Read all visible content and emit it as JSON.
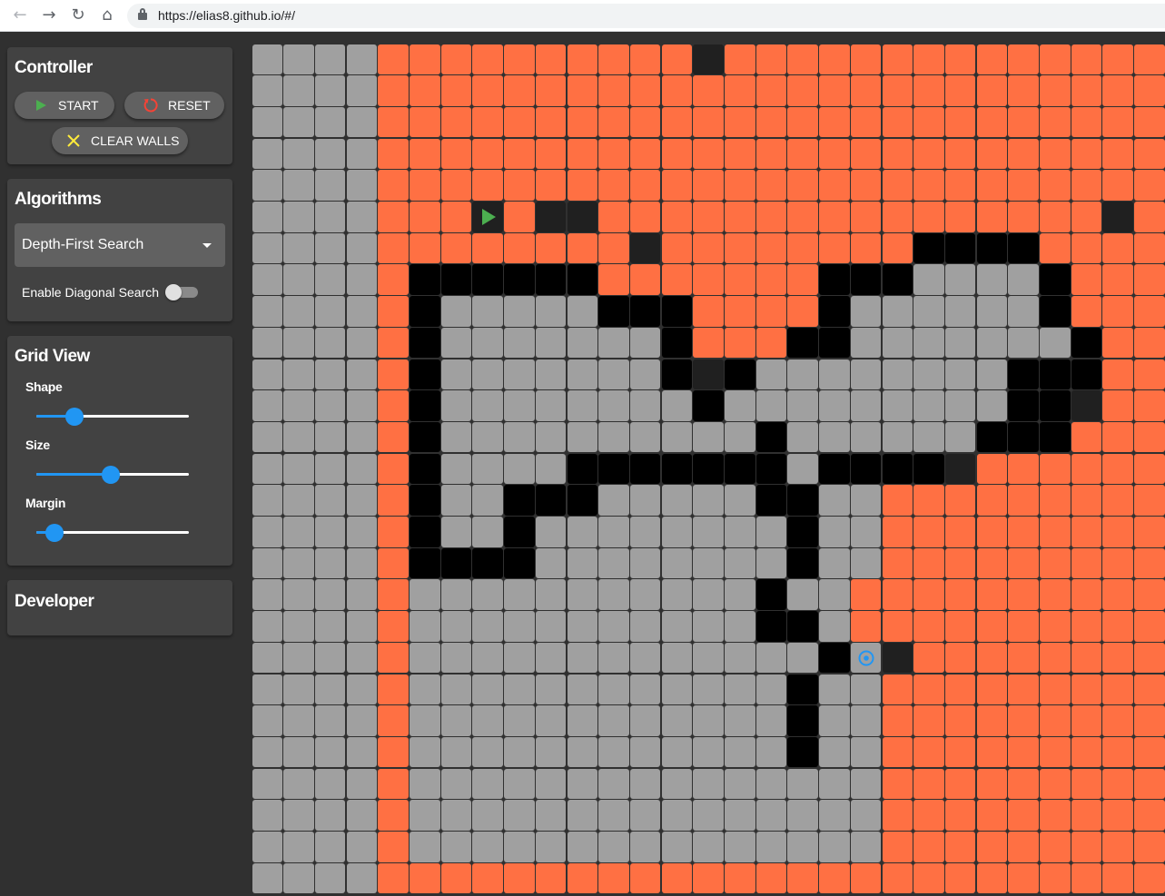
{
  "browser": {
    "url": "https://elias8.github.io/#/",
    "icons": [
      "back-icon",
      "forward-icon",
      "reload-icon",
      "home-icon",
      "lock-icon"
    ]
  },
  "controller": {
    "title": "Controller",
    "start_label": "START",
    "reset_label": "RESET",
    "clear_walls_label": "CLEAR WALLS"
  },
  "algorithms": {
    "title": "Algorithms",
    "selected": "Depth-First Search",
    "diagonal_label": "Enable Diagonal Search",
    "diagonal_enabled": false
  },
  "grid_view": {
    "title": "Grid View",
    "shape_label": "Shape",
    "shape_value": 0.25,
    "size_label": "Size",
    "size_value": 0.49,
    "margin_label": "Margin",
    "margin_value": 0.12
  },
  "developer": {
    "title": "Developer"
  },
  "colors": {
    "unvisited": "#a0a0a0",
    "visited": "#ff7043",
    "wall": "#000000",
    "dark_cell": "#202020",
    "start": "#4caf50",
    "target": "#2196f3",
    "accent": "#2196f3"
  },
  "grid": {
    "rows": 27,
    "cols": 29,
    "start": [
      5,
      7
    ],
    "target": [
      19,
      19
    ],
    "legend": "g=unvisited, o=visited, b=wall, d=dark cell",
    "cells": [
      "ggggoooooooooodoooooooooooooo",
      "ggggoooooooooooooooooooooooo",
      "ggggoooooooooooooooooooooooo",
      "ggggoooooooooooooooooooooooo",
      "ggggoooooooooooooooooooooooo",
      "ggggooododdoooooooooooooooodo",
      "ggggoooooooodoooooooobbbbooo",
      "ggggobbbbbbooooooobbbggggboo",
      "ggggobgggggbbboooobggggggboo",
      "ggggobgggggggbooobbgggggggboo",
      "ggggobgggggggbdbggggggggbbboo",
      "ggggobggggggggbgggggggggbbdoo",
      "ggggobggggggggggbggggggbbbooo",
      "ggggobggggbbbbbbbgbbbbdoooooo",
      "ggggobggbbbgggggbbggooooooooo",
      "ggggobggbggggggggbggooooooooo",
      "ggggobbbbggggggggbggooooooooo",
      "ggggogggggggggggbggoooooooooo",
      "ggggogggggggggggbbgoooooooooo",
      "ggggogggggggggggggbgdoooooooo",
      "ggggoggggggggggggbggooooooooo",
      "ggggoggggggggggggbggooooooooo",
      "ggggoggggggggggggbggooooooooo",
      "ggggogggggggggggggggooooooooo",
      "ggggogggggggggggggggooooooooo",
      "ggggogggggggggggggggooooooooo",
      "ggggooooooooooooooooooooooooo"
    ]
  }
}
